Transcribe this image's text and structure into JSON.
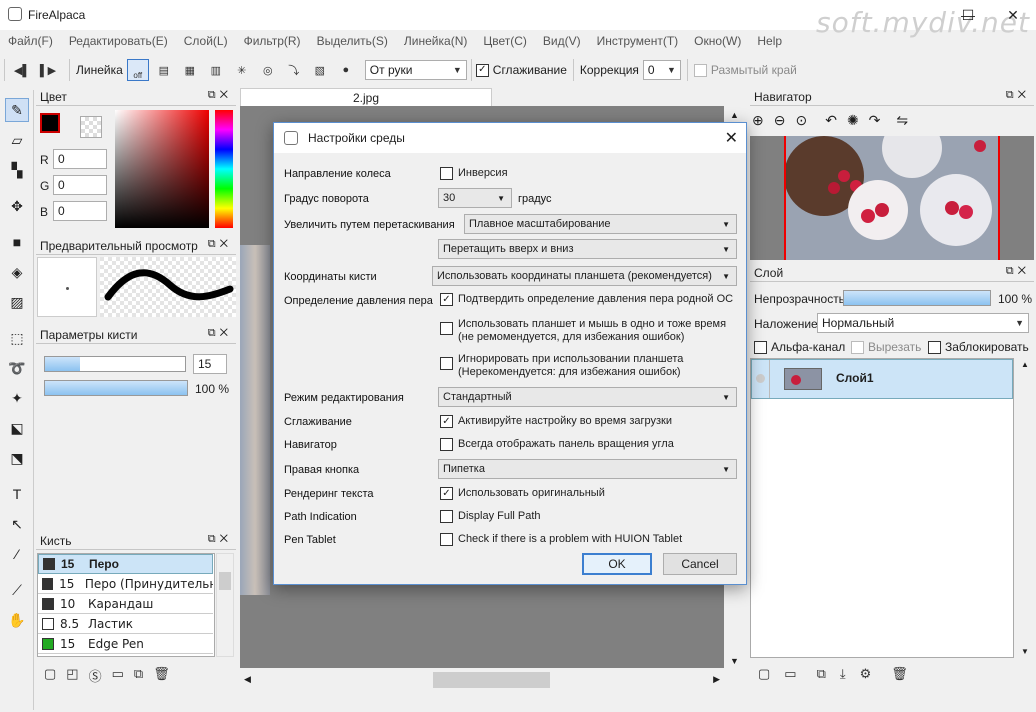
{
  "window": {
    "title": "FireAlpaca",
    "watermark": "soft.mydiv.net"
  },
  "menu": [
    "Файл(F)",
    "Редактировать(E)",
    "Слой(L)",
    "Фильтр(R)",
    "Выделить(S)",
    "Линейка(N)",
    "Цвет(C)",
    "Вид(V)",
    "Инструмент(T)",
    "Окно(W)",
    "Help"
  ],
  "toolbar": {
    "ruler_label": "Линейка",
    "ruler_off": "off",
    "stroke_mode": "От руки",
    "smoothing_label": "Сглаживание",
    "smoothing_checked": true,
    "correction_label": "Коррекция",
    "correction_value": "0",
    "blur_edge_label": "Размытый край"
  },
  "color_panel": {
    "title": "Цвет",
    "r_label": "R",
    "r": "0",
    "g_label": "G",
    "g": "0",
    "b_label": "B",
    "b": "0",
    "primary": "#000000"
  },
  "preview_panel": {
    "title": "Предварительный просмотр"
  },
  "brush_params": {
    "title": "Параметры кисти",
    "size": "15",
    "opacity": "100 %",
    "size_fraction": 0.25,
    "opacity_fraction": 1.0
  },
  "brush_panel": {
    "title": "Кисть",
    "items": [
      {
        "size": "15",
        "name": "Перо",
        "color": "#333333",
        "selected": true
      },
      {
        "size": "15",
        "name": "Перо (Принудительно",
        "color": "#333333"
      },
      {
        "size": "10",
        "name": "Карандаш",
        "color": "#333333"
      },
      {
        "size": "8.5",
        "name": "Ластик",
        "color": "#ffffff"
      },
      {
        "size": "15",
        "name": "Edge Pen",
        "color": "#22aa22"
      }
    ]
  },
  "document": {
    "tab": "2.jpg"
  },
  "navigator": {
    "title": "Навигатор"
  },
  "layer_panel": {
    "title": "Слой",
    "opacity_label": "Непрозрачность",
    "opacity_value": "100 %",
    "opacity_fraction": 1.0,
    "blend_label": "Наложение",
    "blend_value": "Нормальный",
    "alpha_label": "Альфа-канал",
    "clip_label": "Вырезать",
    "lock_label": "Заблокировать",
    "layer_name": "Слой1"
  },
  "dialog": {
    "title": "Настройки среды",
    "wheel_dir_label": "Направление колеса",
    "wheel_dir_option": "Инверсия",
    "wheel_dir_checked": false,
    "rotation_label": "Градус поворота",
    "rotation_value": "30",
    "rotation_unit": "градус",
    "drag_zoom_label": "Увеличить путем перетаскивания",
    "drag_zoom_value": "Плавное масштабирование",
    "drag_dir_value": "Перетащить вверх и вниз",
    "brush_coords_label": "Координаты кисти",
    "brush_coords_value": "Использовать координаты планшета (рекомендуется)",
    "pressure_label": "Определение давления пера",
    "pressure_opt1": "Подтвердить определение давления пера родной ОС",
    "pressure_opt1_checked": true,
    "pressure_opt2_l1": "Использовать планшет и мышь в одно и тоже время",
    "pressure_opt2_l2": "(не ремомендуется, для избежания ошибок)",
    "pressure_opt3_l1": "Игнорировать при использовании планшета",
    "pressure_opt3_l2": "(Нерекомендуется: для избежания ошибок)",
    "edit_mode_label": "Режим редактирования",
    "edit_mode_value": "Стандартный",
    "smoothing_label": "Сглаживание",
    "smoothing_option": "Активируйте настройку во время загрузки",
    "navigator_label": "Навигатор",
    "navigator_option": "Всегда отображать панель вращения угла",
    "right_button_label": "Правая кнопка",
    "right_button_value": "Пипетка",
    "text_render_label": "Рендеринг текста",
    "text_render_option": "Использовать оригинальный",
    "path_label": "Path Indication",
    "path_option": "Display Full Path",
    "pen_tablet_label": "Pen Tablet",
    "pen_tablet_option": "Check if there is a problem with HUION Tablet",
    "ok_label": "OK",
    "cancel_label": "Cancel"
  }
}
